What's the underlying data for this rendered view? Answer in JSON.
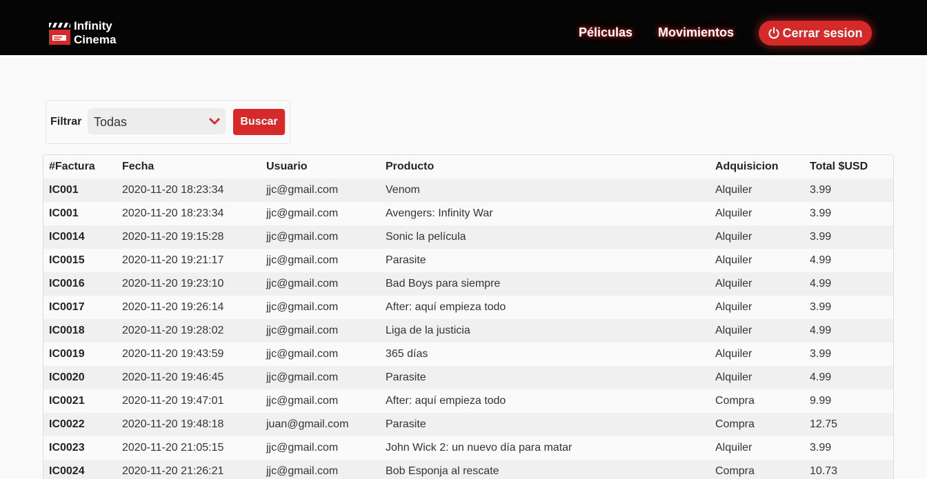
{
  "navbar": {
    "brand_line1": "Infinity",
    "brand_line2": "Cinema",
    "links": [
      "Péliculas",
      "Movimientos"
    ],
    "logout_label": "Cerrar sesion",
    "logout_icon": "power-icon",
    "accent_color": "#d62a2a"
  },
  "filter": {
    "label": "Filtrar",
    "selected": "Todas",
    "button_label": "Buscar"
  },
  "table": {
    "headers": [
      "#Factura",
      "Fecha",
      "Usuario",
      "Producto",
      "Adquisicion",
      "Total $USD"
    ],
    "rows": [
      [
        "IC001",
        "2020-11-20 18:23:34",
        "jjc@gmail.com",
        "Venom",
        "Alquiler",
        "3.99"
      ],
      [
        "IC001",
        "2020-11-20 18:23:34",
        "jjc@gmail.com",
        "Avengers: Infinity War",
        "Alquiler",
        "3.99"
      ],
      [
        "IC0014",
        "2020-11-20 19:15:28",
        "jjc@gmail.com",
        "Sonic la película",
        "Alquiler",
        "3.99"
      ],
      [
        "IC0015",
        "2020-11-20 19:21:17",
        "jjc@gmail.com",
        "Parasite",
        "Alquiler",
        "4.99"
      ],
      [
        "IC0016",
        "2020-11-20 19:23:10",
        "jjc@gmail.com",
        "Bad Boys para siempre",
        "Alquiler",
        "4.99"
      ],
      [
        "IC0017",
        "2020-11-20 19:26:14",
        "jjc@gmail.com",
        "After: aquí empieza todo",
        "Alquiler",
        "3.99"
      ],
      [
        "IC0018",
        "2020-11-20 19:28:02",
        "jjc@gmail.com",
        "Liga de la justicia",
        "Alquiler",
        "4.99"
      ],
      [
        "IC0019",
        "2020-11-20 19:43:59",
        "jjc@gmail.com",
        "365 días",
        "Alquiler",
        "3.99"
      ],
      [
        "IC0020",
        "2020-11-20 19:46:45",
        "jjc@gmail.com",
        "Parasite",
        "Alquiler",
        "4.99"
      ],
      [
        "IC0021",
        "2020-11-20 19:47:01",
        "jjc@gmail.com",
        "After: aquí empieza todo",
        "Compra",
        "9.99"
      ],
      [
        "IC0022",
        "2020-11-20 19:48:18",
        "juan@gmail.com",
        "Parasite",
        "Compra",
        "12.75"
      ],
      [
        "IC0023",
        "2020-11-20 21:05:15",
        "jjc@gmail.com",
        "John Wick 2: un nuevo día para matar",
        "Alquiler",
        "3.99"
      ],
      [
        "IC0024",
        "2020-11-20 21:26:21",
        "jjc@gmail.com",
        "Bob Esponja al rescate",
        "Compra",
        "10.73"
      ]
    ]
  }
}
